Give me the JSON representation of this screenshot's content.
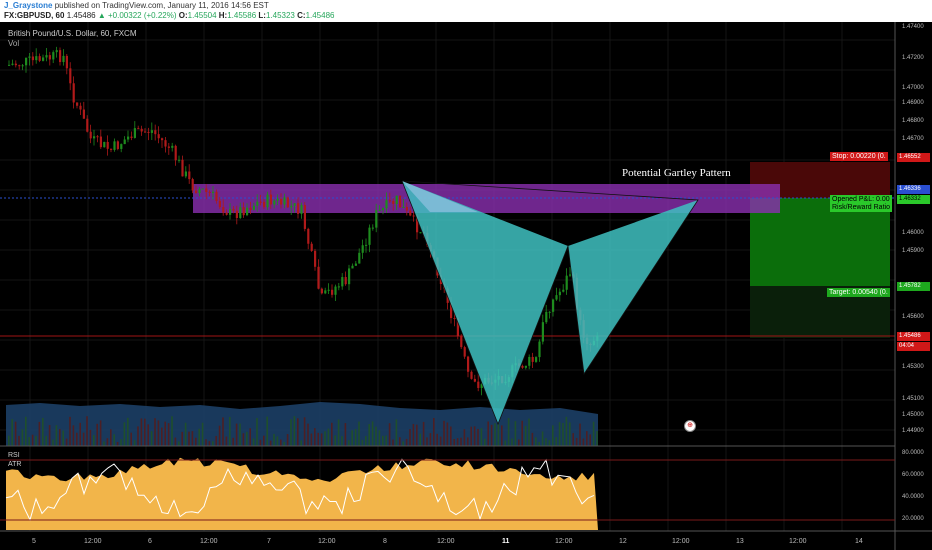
{
  "header": {
    "user": "J_Graystone",
    "published": "published on TradingView.com, January 11, 2016 14:56 EST",
    "symbol": "FX:GBPUSD, 60",
    "last": "1.45486",
    "change": "▲ +0.00322 (+0.22%)",
    "o_label": "O:",
    "o_value": "1.45504",
    "h_label": "H:",
    "h_value": "1.45586",
    "l_label": "L:",
    "l_value": "1.45323",
    "c_label": "C:",
    "c_value": "1.45486"
  },
  "legend": {
    "symbol_title": "British Pound/U.S. Dollar, 60, FXCM",
    "volume_label": "Vol",
    "rsi_label": "RSI",
    "atr_label": "ATR"
  },
  "annotations": {
    "pattern_label": "Potential Gartley Pattern",
    "stop_label": "Stop: 0.00220 (0.",
    "pnl_label": "Opened P&L: 0.00",
    "rr_label": "Risk/Reward Ratio",
    "target_label": "Target: 0.00540 (0.",
    "flag_icon": "uk-flag-icon"
  },
  "price_tags": {
    "stop": "1.46552",
    "blue": "1.46336",
    "entry": "1.46332",
    "target": "1.45782",
    "last": "1.45486",
    "countdown": "04:04"
  },
  "colors": {
    "background": "#000000",
    "bull": "#1e8c1e",
    "bear": "#b01a1a",
    "pattern": "#3fc1c1",
    "zone": "#8b2fb0",
    "profit": "#0a7a0a",
    "loss": "#6a0a0a",
    "rsi_fill": "#f2b54a"
  },
  "chart_data": {
    "type": "candlestick",
    "y_labels": [
      "1.47400",
      "1.47200",
      "1.47000",
      "1.46900",
      "1.46800",
      "1.46700",
      "1.46552",
      "1.46336",
      "1.46332",
      "1.46000",
      "1.45900",
      "1.45782",
      "1.45600",
      "1.45486",
      "1.45300",
      "1.45100",
      "1.45000",
      "1.44900"
    ],
    "osc_labels": [
      "80.0000",
      "60.0000",
      "40.0000",
      "20.0000"
    ],
    "x_labels": [
      "5",
      "12:00",
      "6",
      "12:00",
      "7",
      "12:00",
      "8",
      "12:00",
      "11",
      "12:00",
      "12",
      "12:00",
      "13",
      "12:00",
      "14"
    ]
  }
}
